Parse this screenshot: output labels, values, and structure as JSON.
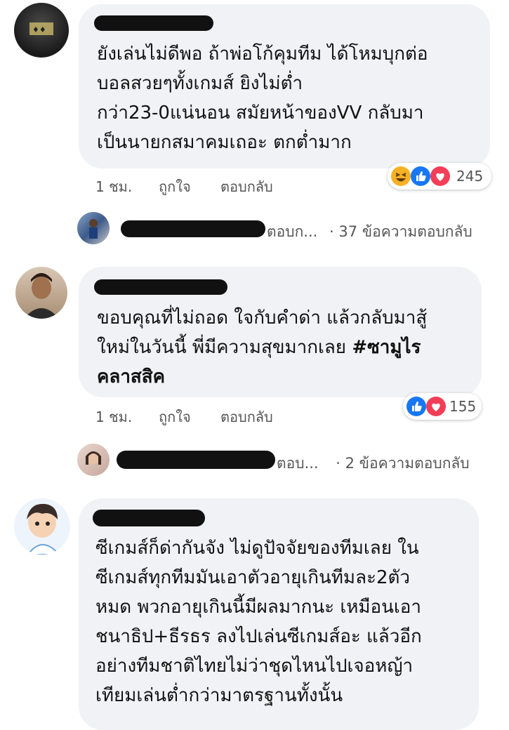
{
  "comments": [
    {
      "text_lines": [
        "ยังเล่นไม่ดีพอ ถ้าพ่อโก้คุมทีม ได้โหมบุกต่อ",
        "บอลสวยๆทั้งเกมส์ ยิงไม่ต่ำ",
        "กว่า23-0แน่นอน สมัยหน้าของVV กลับมา",
        "เป็นนายกสมาคมเถอะ ตกต่ำมาก"
      ],
      "time": "1 ชม.",
      "like": "ถูกใจ",
      "reply": "ตอบกลับ",
      "reaction_count": "245",
      "reply_preview": "ตอบก...",
      "reply_count": "· 37 ข้อความตอบกลับ"
    },
    {
      "text_lines": [
        "ขอบคุณที่ไม่ถอด ใจกับคำด่า แล้วกลับมาสู้",
        "ใหม่ในวันนี้ พี่มีความสุขมากเลย "
      ],
      "hashtag_1": "#ซามูไร",
      "hashtag_2": "คลาสสิค",
      "time": "1 ชม.",
      "like": "ถูกใจ",
      "reply": "ตอบกลับ",
      "reaction_count": "155",
      "reply_preview": "ตอบ...",
      "reply_count": "· 2 ข้อความตอบกลับ"
    },
    {
      "text_lines": [
        "ซีเกมส์ก็ด่ากันจัง ไม่ดูปัจจัยของทีมเลย ใน",
        "ซีเกมส์ทุกทีมมันเอาตัวอายุเกินทีมละ2ตัว",
        "หมด พวกอายุเกินนี้มีผลมากนะ เหมือนเอา",
        "ชนาธิป+ธีรธร ลงไปเล่นซีเกมส์อะ แล้วอีก",
        "อย่างทีมชาติไทยไม่ว่าชุดไหนไปเจอหญ้า",
        "เทียมเล่นต่ำกว่ามาตรฐานทั้งนั้น"
      ]
    }
  ],
  "colors": {
    "bubble": "#f0f2f5",
    "like_blue": "#1877f2",
    "love_red": "#f33e58",
    "haha_yellow": "#f7b125"
  }
}
